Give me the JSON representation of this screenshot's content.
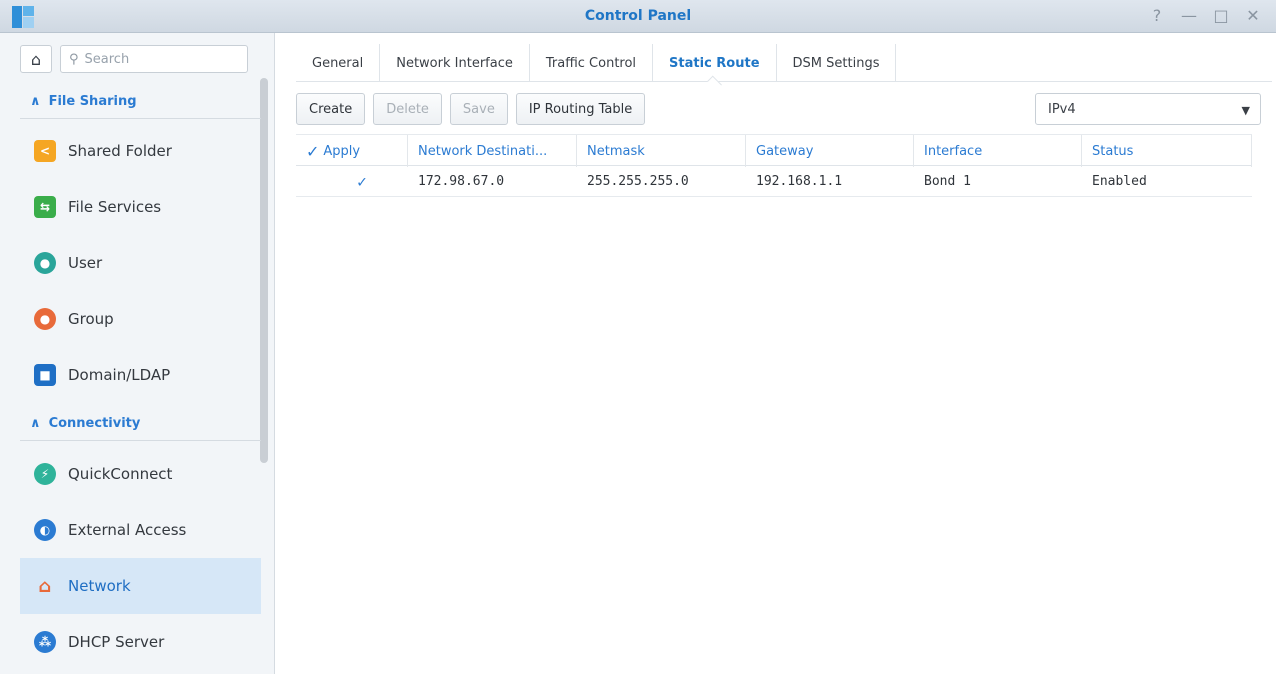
{
  "window": {
    "title": "Control Panel",
    "controls": [
      "?",
      "—",
      "□",
      "✕"
    ]
  },
  "sidebar": {
    "search_placeholder": "Search",
    "sections": [
      {
        "label": "File Sharing"
      },
      {
        "label": "Connectivity"
      }
    ],
    "items": [
      {
        "label": "Shared Folder",
        "icon": "shared-folder-icon",
        "color": "#f5a623"
      },
      {
        "label": "File Services",
        "icon": "file-services-icon",
        "color": "#3aad4a"
      },
      {
        "label": "User",
        "icon": "user-icon",
        "color": "#2aa59a"
      },
      {
        "label": "Group",
        "icon": "group-icon",
        "color": "#e86a3a"
      },
      {
        "label": "Domain/LDAP",
        "icon": "domain-ldap-icon",
        "color": "#1f6fc5"
      },
      {
        "label": "QuickConnect",
        "icon": "quickconnect-icon",
        "color": "#2fb39a"
      },
      {
        "label": "External Access",
        "icon": "external-access-icon",
        "color": "#2b7bd2"
      },
      {
        "label": "Network",
        "icon": "network-icon",
        "color": "#e86a3a",
        "active": true
      },
      {
        "label": "DHCP Server",
        "icon": "dhcp-server-icon",
        "color": "#2b7bd2"
      }
    ]
  },
  "tabs": [
    "General",
    "Network Interface",
    "Traffic Control",
    "Static Route",
    "DSM Settings"
  ],
  "active_tab": "Static Route",
  "toolbar": {
    "create": "Create",
    "delete": "Delete",
    "save": "Save",
    "routing_table": "IP Routing Table"
  },
  "ip_version": "IPv4",
  "table": {
    "headers": [
      "Apply",
      "Network Destinati...",
      "Netmask",
      "Gateway",
      "Interface",
      "Status"
    ],
    "rows": [
      {
        "apply": true,
        "destination": "172.98.67.0",
        "netmask": "255.255.255.0",
        "gateway": "192.168.1.1",
        "interface": "Bond 1",
        "status": "Enabled"
      }
    ]
  }
}
